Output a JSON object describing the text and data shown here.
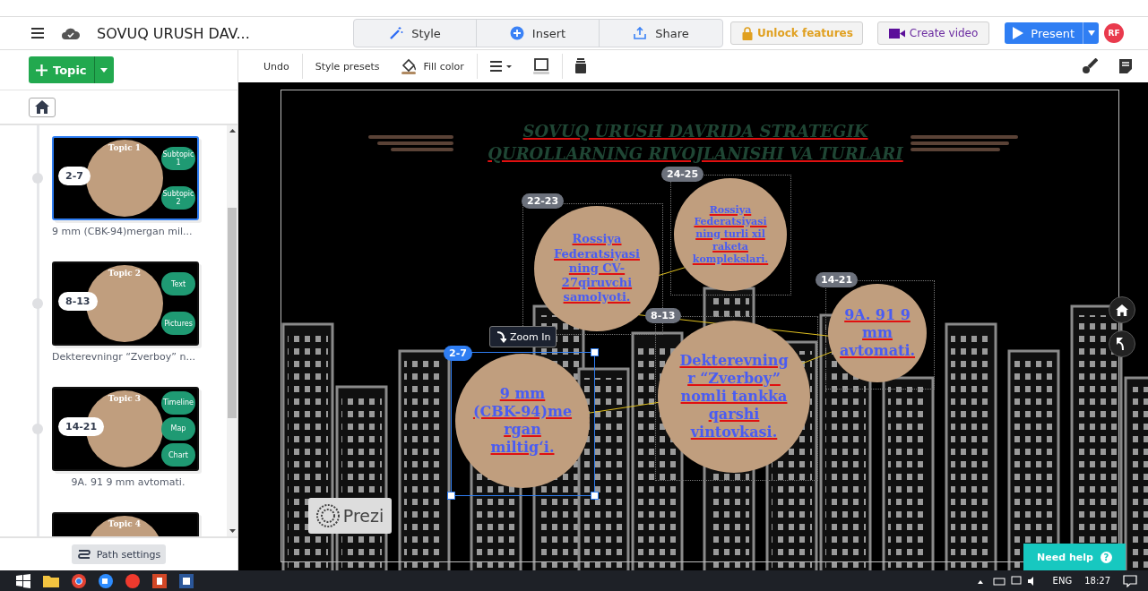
{
  "header": {
    "title": "SOVUQ URUSH DAV...",
    "tabs": [
      {
        "label": "Style",
        "kind": "style"
      },
      {
        "label": "Insert",
        "kind": "insert"
      },
      {
        "label": "Share",
        "kind": "share"
      }
    ],
    "unlock": "Unlock features",
    "create_video": "Create video",
    "present": "Present",
    "avatar": "RF"
  },
  "toolbar": {
    "undo": "Undo",
    "style_presets": "Style presets",
    "fill_color": "Fill color"
  },
  "sidebar": {
    "topic_button": "Topic",
    "path_settings": "Path settings",
    "items": [
      {
        "path": "2-7",
        "topic": "Topic 1",
        "caption": "9 mm (CBK-94)mergan mil...",
        "selected": true,
        "subtopics": [
          "Subtopic 1",
          "Subtopic 2"
        ]
      },
      {
        "path": "8-13",
        "topic": "Topic 2",
        "caption": "Dekterevningr “Zverboy” n...",
        "selected": false,
        "subtopics": [
          "Text",
          "Pictures"
        ]
      },
      {
        "path": "14-21",
        "topic": "Topic 3",
        "caption": "9A. 91 9 mm avtomati.",
        "selected": false,
        "subtopics": [
          "Timeline",
          "Map",
          "Chart"
        ]
      },
      {
        "topic": "Topic 4",
        "selected": false
      }
    ]
  },
  "canvas": {
    "title_lines": [
      "SOVUQ URUSH DAVRIDA STRATEGIK",
      "QUROLLARNING RIVOJLANISHI VA TURLARI"
    ],
    "topics": [
      {
        "path": "22-23",
        "lines": [
          "Rossiya",
          "Federatsiyasi",
          "ning CV-",
          "27qiruvchi",
          "samolyoti."
        ],
        "selected": false
      },
      {
        "path": "24-25",
        "lines": [
          "Rossiya",
          "Federatsiyasi",
          "ning turli xil",
          "raketa",
          "komplekslari."
        ],
        "selected": false
      },
      {
        "path": "14-21",
        "lines": [
          "9A. 91 9",
          "mm",
          "avtomati."
        ],
        "selected": false
      },
      {
        "path": "8-13",
        "lines": [
          "Dekterevning",
          "r “Zverboy”",
          "nomli tankka",
          "qarshi",
          "vintovkasi."
        ],
        "selected": false
      },
      {
        "path": "2-7",
        "lines": [
          "9 mm",
          "(CBK-94)me",
          "rgan",
          "miltig‘i."
        ],
        "selected": true
      }
    ],
    "zoom_in": "Zoom In",
    "logo": "Prezi",
    "need_help": "Need help",
    "help_mark": "?"
  },
  "taskbar": {
    "language": "ENG",
    "time": "18:27"
  }
}
